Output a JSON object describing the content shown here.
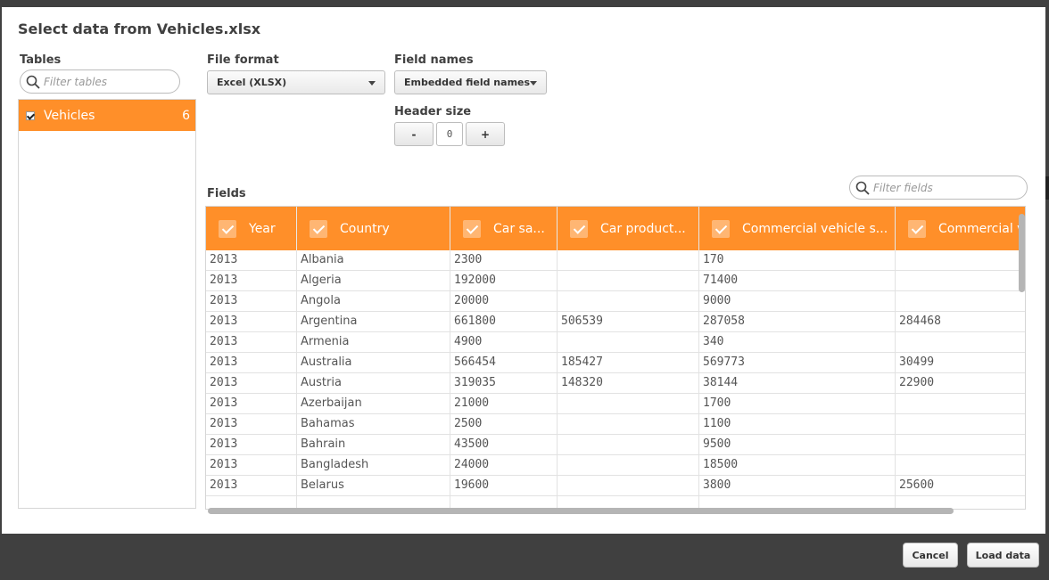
{
  "dialog": {
    "title": "Select data from Vehicles.xlsx"
  },
  "tables": {
    "label": "Tables",
    "filter_placeholder": "Filter tables",
    "items": [
      {
        "name": "Vehicles",
        "count": "6",
        "checked": true
      }
    ]
  },
  "file_format": {
    "label": "File format",
    "value": "Excel (XLSX)"
  },
  "field_names": {
    "label": "Field names",
    "value": "Embedded field names"
  },
  "header_size": {
    "label": "Header size",
    "minus": "-",
    "value": "0",
    "plus": "+"
  },
  "fields": {
    "label": "Fields",
    "filter_placeholder": "Filter fields",
    "columns": [
      "Year",
      "Country",
      "Car sa...",
      "Car product...",
      "Commercial vehicle s...",
      "Commercial v"
    ],
    "rows": [
      [
        "2013",
        "Albania",
        "2300",
        "",
        "170",
        ""
      ],
      [
        "2013",
        "Algeria",
        "192000",
        "",
        "71400",
        ""
      ],
      [
        "2013",
        "Angola",
        "20000",
        "",
        "9000",
        ""
      ],
      [
        "2013",
        "Argentina",
        "661800",
        "506539",
        "287058",
        "284468"
      ],
      [
        "2013",
        "Armenia",
        "4900",
        "",
        "340",
        ""
      ],
      [
        "2013",
        "Australia",
        "566454",
        "185427",
        "569773",
        "30499"
      ],
      [
        "2013",
        "Austria",
        "319035",
        "148320",
        "38144",
        "22900"
      ],
      [
        "2013",
        "Azerbaijan",
        "21000",
        "",
        "1700",
        ""
      ],
      [
        "2013",
        "Bahamas",
        "2500",
        "",
        "1100",
        ""
      ],
      [
        "2013",
        "Bahrain",
        "43500",
        "",
        "9500",
        ""
      ],
      [
        "2013",
        "Bangladesh",
        "24000",
        "",
        "18500",
        ""
      ],
      [
        "2013",
        "Belarus",
        "19600",
        "",
        "3800",
        "25600"
      ],
      [
        "",
        "",
        "",
        "",
        "",
        ""
      ]
    ]
  },
  "footer": {
    "cancel": "Cancel",
    "load": "Load data"
  },
  "colors": {
    "accent": "#ff8f29",
    "frame": "#404040"
  }
}
